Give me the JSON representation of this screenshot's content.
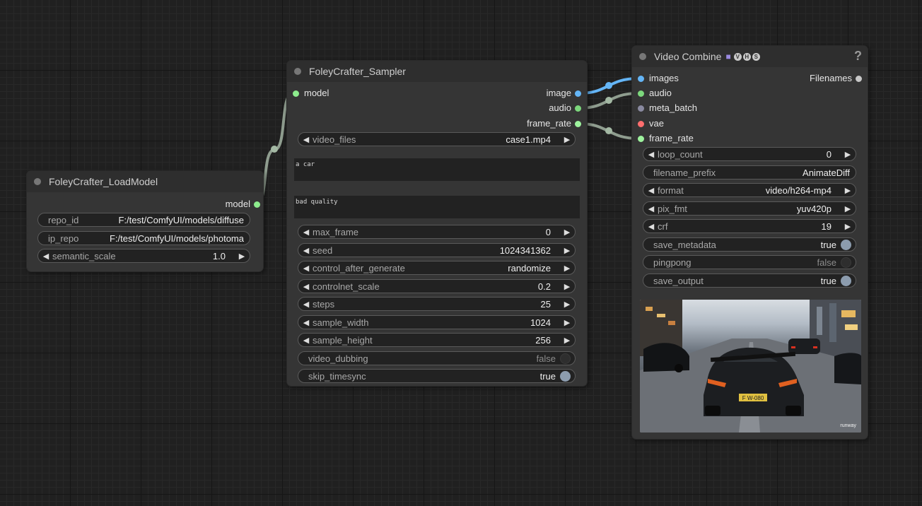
{
  "load_model": {
    "title": "FoleyCrafter_LoadModel",
    "output_model": "model",
    "repo_id_label": "repo_id",
    "repo_id_value": "F:/test/ComfyUI/models/diffuse",
    "ip_repo_label": "ip_repo",
    "ip_repo_value": "F:/test/ComfyUI/models/photoma",
    "semantic_scale_label": "semantic_scale",
    "semantic_scale_value": "1.0"
  },
  "sampler": {
    "title": "FoleyCrafter_Sampler",
    "input_model": "model",
    "output_image": "image",
    "output_audio": "audio",
    "output_frame_rate": "frame_rate",
    "video_files_label": "video_files",
    "video_files_value": "case1.mp4",
    "prompt": "a car",
    "negative_prompt": "bad quality",
    "max_frame_label": "max_frame",
    "max_frame_value": "0",
    "seed_label": "seed",
    "seed_value": "1024341362",
    "control_after_generate_label": "control_after_generate",
    "control_after_generate_value": "randomize",
    "controlnet_scale_label": "controlnet_scale",
    "controlnet_scale_value": "0.2",
    "steps_label": "steps",
    "steps_value": "25",
    "sample_width_label": "sample_width",
    "sample_width_value": "1024",
    "sample_height_label": "sample_height",
    "sample_height_value": "256",
    "video_dubbing_label": "video_dubbing",
    "video_dubbing_value": "false",
    "skip_timesync_label": "skip_timesync",
    "skip_timesync_value": "true"
  },
  "video_combine": {
    "title": "Video Combine",
    "badges": [
      "V",
      "H",
      "S"
    ],
    "help": "?",
    "input_images": "images",
    "input_audio": "audio",
    "input_meta_batch": "meta_batch",
    "input_vae": "vae",
    "input_frame_rate": "frame_rate",
    "output_filenames": "Filenames",
    "loop_count_label": "loop_count",
    "loop_count_value": "0",
    "filename_prefix_label": "filename_prefix",
    "filename_prefix_value": "AnimateDiff",
    "format_label": "format",
    "format_value": "video/h264-mp4",
    "pix_fmt_label": "pix_fmt",
    "pix_fmt_value": "yuv420p",
    "crf_label": "crf",
    "crf_value": "19",
    "save_metadata_label": "save_metadata",
    "save_metadata_value": "true",
    "pingpong_label": "pingpong",
    "pingpong_value": "false",
    "save_output_label": "save_output",
    "save_output_value": "true",
    "preview_plate": "F W-080",
    "preview_watermark": "runway"
  },
  "colors": {
    "link_model": "#a3b8a3",
    "link_image": "#64b5f6",
    "link_audio": "#9aa99a",
    "toggle_on": "#8c9cae"
  },
  "icons": [
    "collapse-dot-icon",
    "film-icon",
    "help-icon",
    "left-arrow-icon",
    "right-arrow-icon"
  ]
}
